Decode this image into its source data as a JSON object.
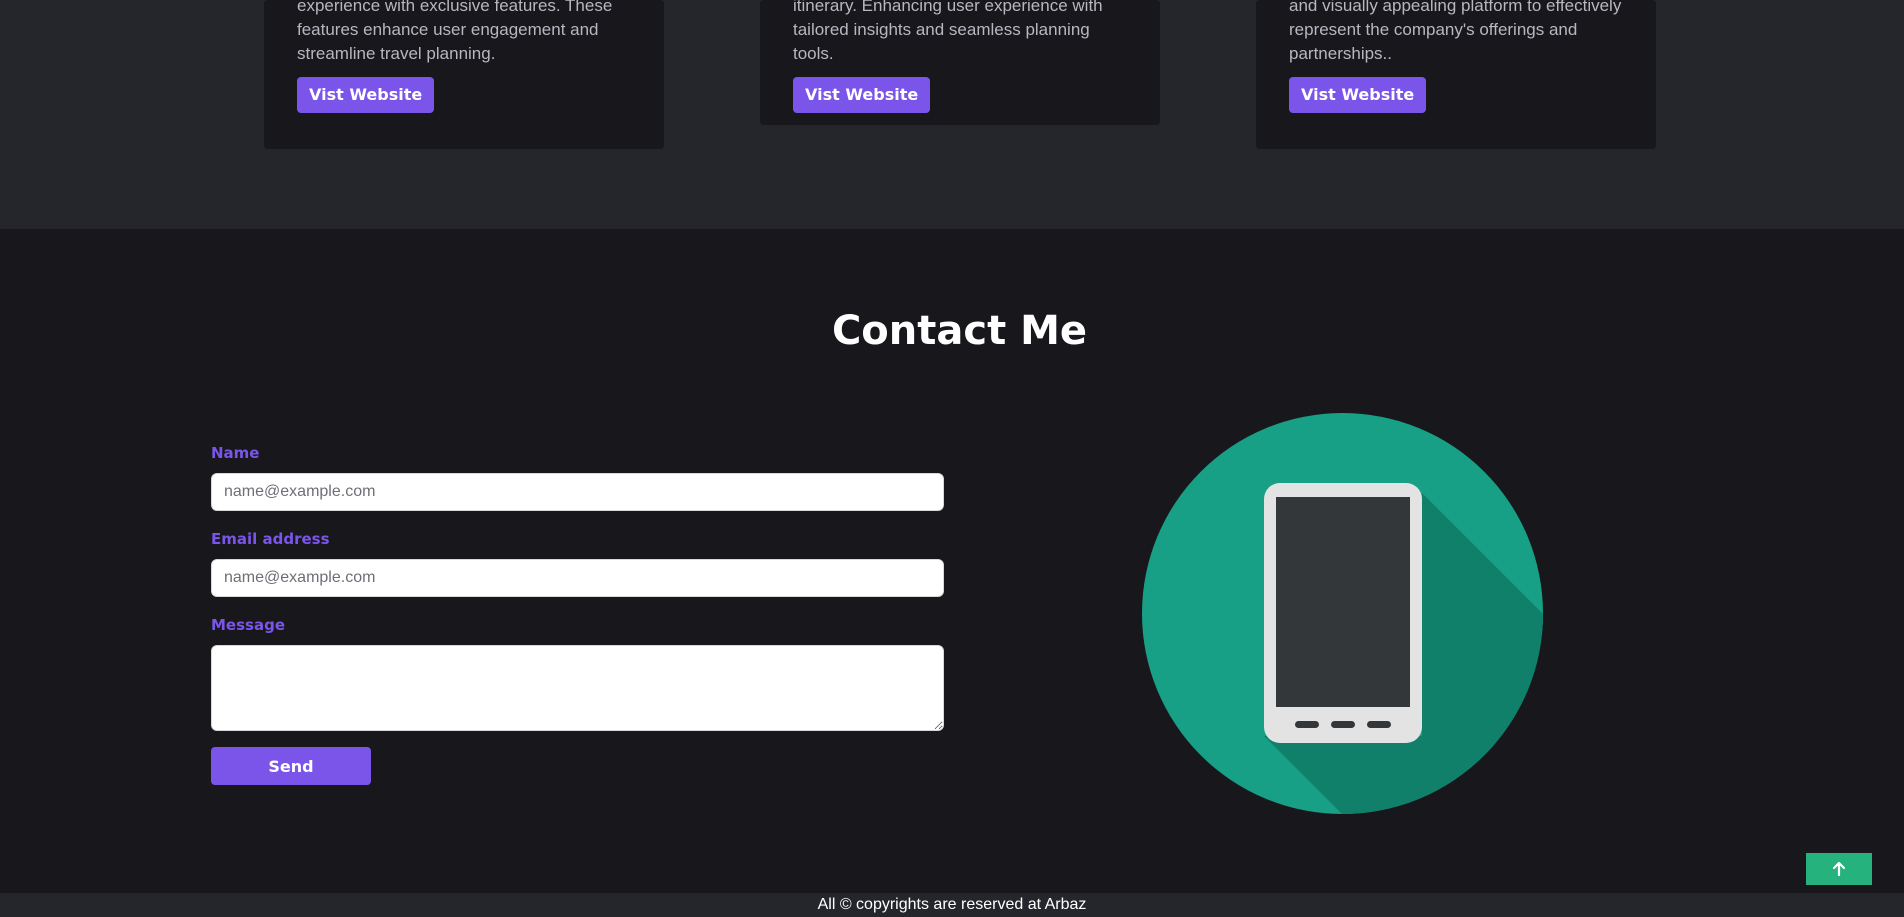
{
  "projects": {
    "cards": [
      {
        "desc_lines": [
          "experience with exclusive features. These",
          "features enhance user engagement and",
          "streamline travel planning."
        ],
        "button_label": "Vist Website"
      },
      {
        "desc_lines": [
          "itinerary. Enhancing user experience with",
          "tailored insights and seamless planning tools."
        ],
        "button_label": "Vist Website"
      },
      {
        "desc_lines": [
          "and visually appealing platform to effectively",
          "represent the company's offerings and",
          "partnerships.."
        ],
        "button_label": "Vist Website"
      }
    ]
  },
  "contact": {
    "title": "Contact Me",
    "name_label": "Name",
    "name_placeholder": "name@example.com",
    "email_label": "Email address",
    "email_placeholder": "name@example.com",
    "message_label": "Message",
    "message_value": "",
    "send_label": "Send",
    "illustration_icon": "smartphone-icon"
  },
  "footer": {
    "text": "All © copyrights are reserved at Arbaz"
  },
  "scroll_top_icon": "arrow-up-icon",
  "colors": {
    "accent": "#7b55ea",
    "scroll_top": "#26b27c",
    "circle": "#17a085"
  }
}
